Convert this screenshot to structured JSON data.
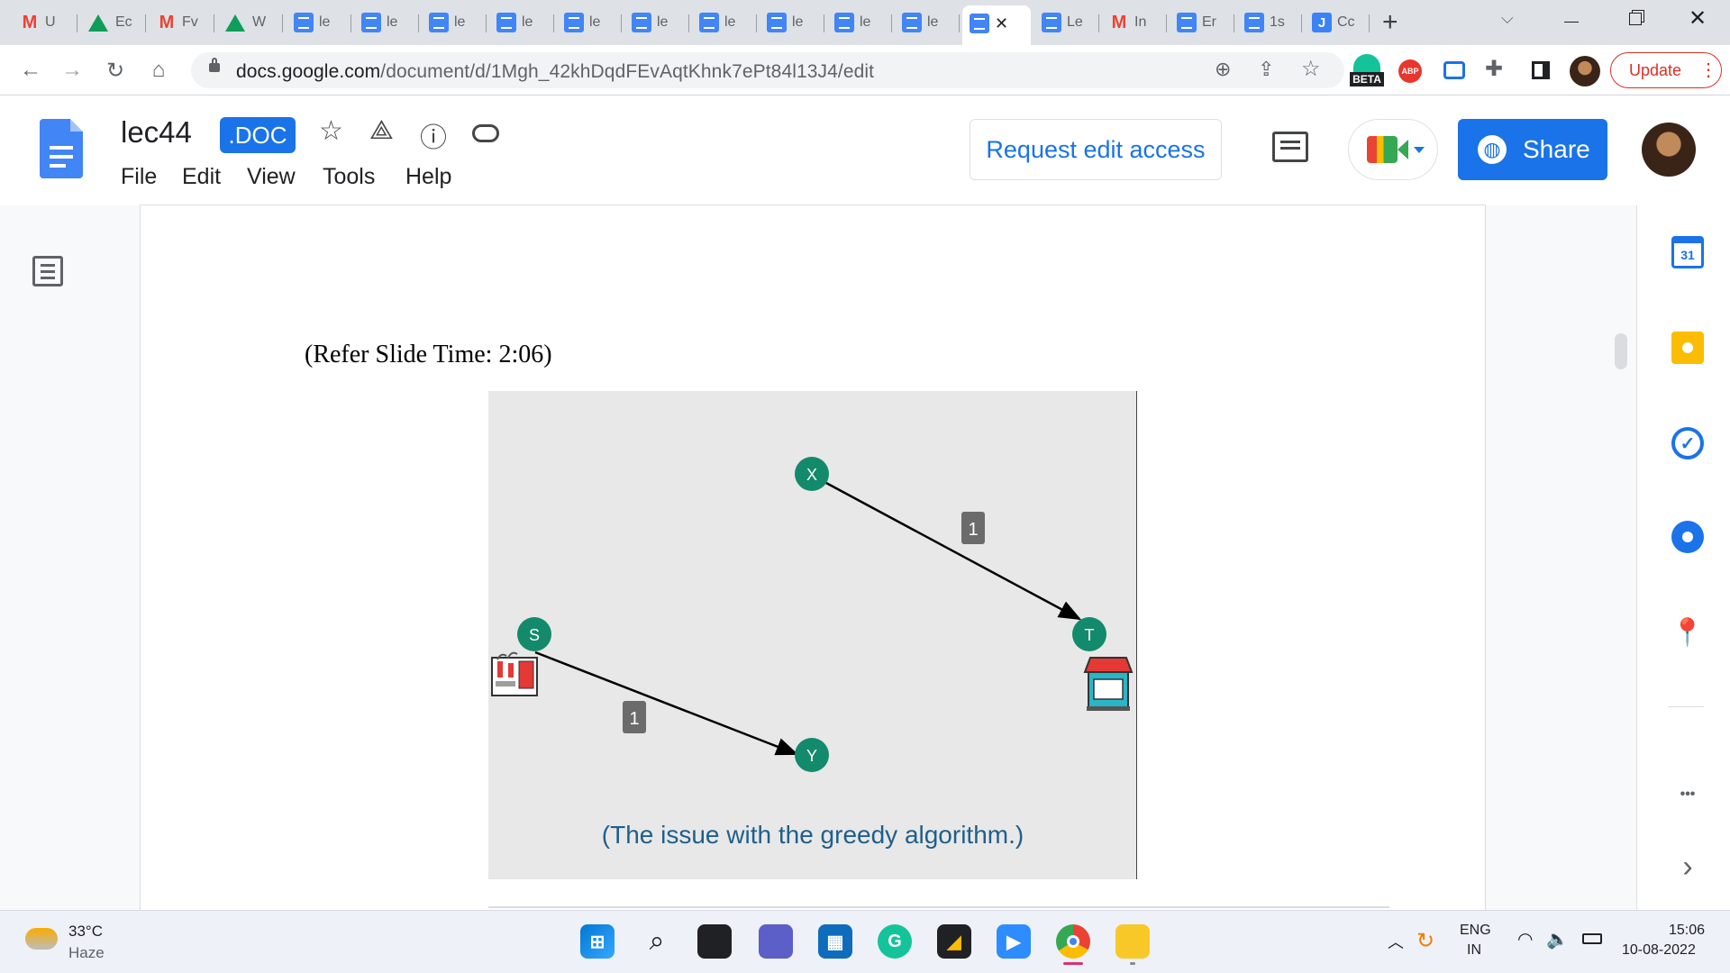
{
  "browser": {
    "tabs": [
      {
        "icon": "gmail-icon",
        "label": "U"
      },
      {
        "icon": "drive-icon",
        "label": "Ec"
      },
      {
        "icon": "gmail-icon",
        "label": "Fv"
      },
      {
        "icon": "drive-icon",
        "label": "W"
      },
      {
        "icon": "docs-icon",
        "label": "le"
      },
      {
        "icon": "docs-icon",
        "label": "le"
      },
      {
        "icon": "docs-icon",
        "label": "le"
      },
      {
        "icon": "docs-icon",
        "label": "le"
      },
      {
        "icon": "docs-icon",
        "label": "le"
      },
      {
        "icon": "docs-icon",
        "label": "le"
      },
      {
        "icon": "docs-icon",
        "label": "le"
      },
      {
        "icon": "docs-icon",
        "label": "le"
      },
      {
        "icon": "docs-icon",
        "label": "le"
      },
      {
        "icon": "docs-icon",
        "label": "le"
      },
      {
        "icon": "docs-icon",
        "label": "",
        "active": true
      },
      {
        "icon": "docs-icon",
        "label": "Le"
      },
      {
        "icon": "gmail-icon",
        "label": "In"
      },
      {
        "icon": "docs-icon",
        "label": "Er"
      },
      {
        "icon": "docs-icon",
        "label": "1s"
      },
      {
        "icon": "j-icon",
        "label": "Cc"
      }
    ],
    "active_close": "✕",
    "new_tab": "+",
    "url_host": "docs.google.com",
    "url_path": "/document/d/1Mgh_42khDqdFEvAqtKhnk7ePt84l13J4/edit",
    "beta_label": "BETA",
    "abp_label": "ABP",
    "update_label": "Update"
  },
  "docs": {
    "title": "lec44",
    "badge": ".DOC",
    "menus": [
      "File",
      "Edit",
      "View",
      "Tools",
      "Help"
    ],
    "request_access": "Request edit access",
    "share_label": "Share"
  },
  "document": {
    "refer_text": "(Refer Slide Time: 2:06)",
    "slide": {
      "nodes": [
        {
          "label": "X"
        },
        {
          "label": "S"
        },
        {
          "label": "T"
        },
        {
          "label": "Y"
        }
      ],
      "edges": [
        {
          "from": "X",
          "to": "T",
          "weight": "1"
        },
        {
          "from": "S",
          "to": "Y",
          "weight": "1"
        }
      ],
      "caption": "(The issue with the greedy algorithm.)",
      "node_color": "#138a6b"
    }
  },
  "side_panel": {
    "calendar_day": "31",
    "more": "•••",
    "expand": "›"
  },
  "taskbar": {
    "weather_temp": "33°C",
    "weather_desc": "Haze",
    "lang_top": "ENG",
    "lang_bottom": "IN",
    "time": "15:06",
    "date": "10-08-2022"
  },
  "colors": {
    "accent": "#1a73e8",
    "update_red": "#d93025",
    "tabstrip": "#dee1e6"
  }
}
